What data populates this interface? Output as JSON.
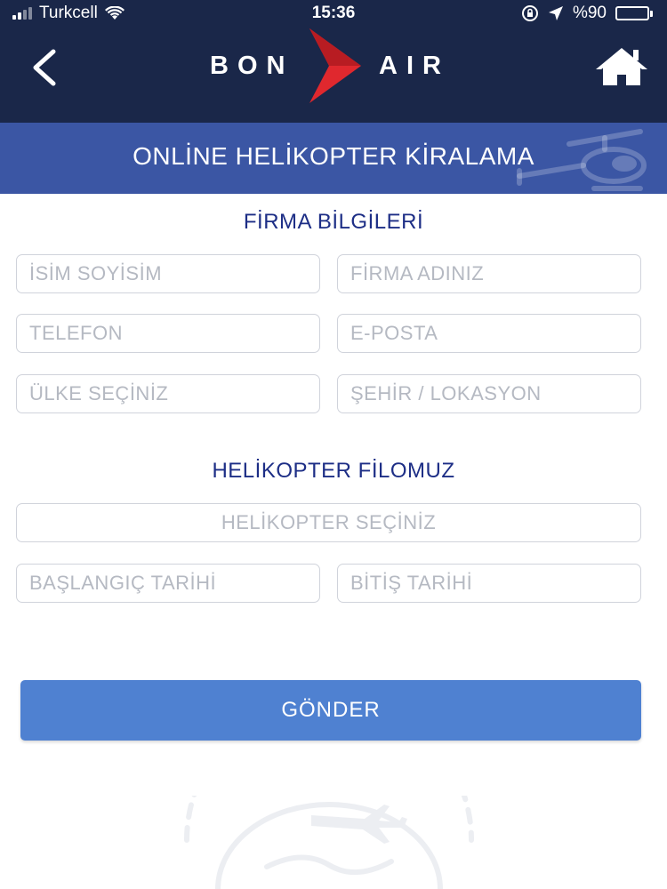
{
  "status_bar": {
    "carrier": "Turkcell",
    "time": "15:36",
    "battery_text": "%90",
    "battery_level": 0.9,
    "icons": [
      "signal-icon",
      "wifi-icon",
      "rotation-lock-icon",
      "location-arrow-icon",
      "battery-icon"
    ]
  },
  "header": {
    "logo_left": "BON",
    "logo_right": "AIR",
    "back_icon": "chevron-left-icon",
    "home_icon": "home-icon"
  },
  "banner": {
    "title": "ONLİNE HELİKOPTER KİRALAMA",
    "decoration_icon": "helicopter-icon"
  },
  "company_section": {
    "title": "FİRMA BİLGİLERİ",
    "fields": {
      "name": {
        "placeholder": "İSİM SOYİSİM",
        "value": ""
      },
      "company": {
        "placeholder": "FİRMA ADINIZ",
        "value": ""
      },
      "phone": {
        "placeholder": "TELEFON",
        "value": ""
      },
      "email": {
        "placeholder": "E-POSTA",
        "value": ""
      },
      "country": {
        "placeholder": "ÜLKE SEÇİNİZ",
        "value": ""
      },
      "city": {
        "placeholder": "ŞEHİR / LOKASYON",
        "value": ""
      }
    }
  },
  "fleet_section": {
    "title": "HELİKOPTER FİLOMUZ",
    "fields": {
      "helicopter": {
        "placeholder": "HELİKOPTER SEÇİNİZ",
        "value": ""
      },
      "start_date": {
        "placeholder": "BAŞLANGIÇ TARİHİ",
        "value": ""
      },
      "end_date": {
        "placeholder": "BİTİŞ TARİHİ",
        "value": ""
      }
    }
  },
  "submit_label": "GÖNDER",
  "colors": {
    "header_bg": "#1a2749",
    "banner_bg": "#3b56a4",
    "section_title": "#1d2e86",
    "button_bg": "#4f81d1",
    "logo_accent": "#e0282e",
    "battery_fill": "#4cd964"
  }
}
